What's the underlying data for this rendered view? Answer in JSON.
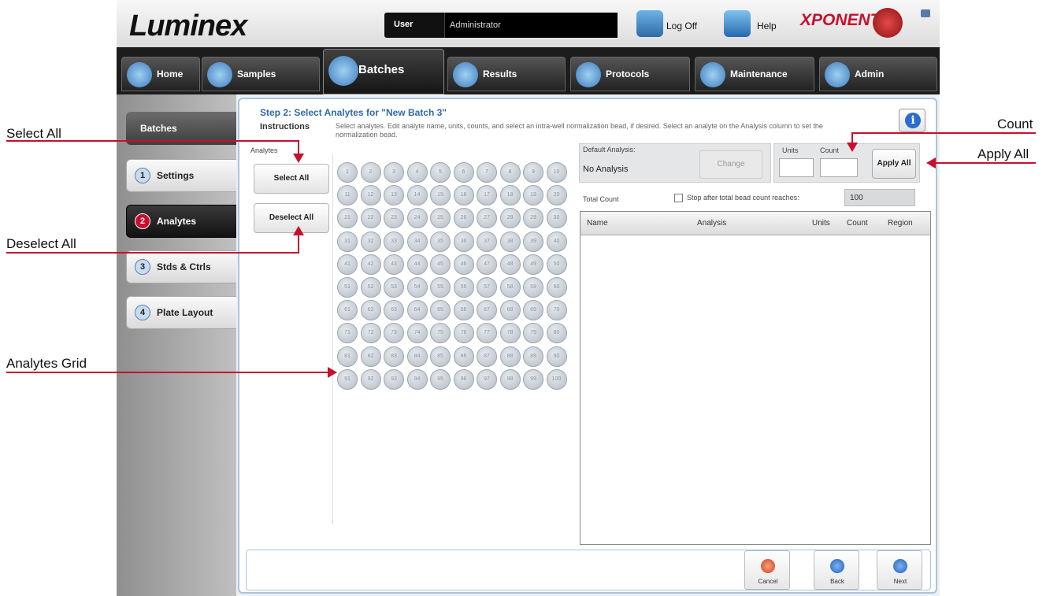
{
  "app": {
    "brand": "Luminex",
    "product": "XPONENT",
    "user_label": "User",
    "user_value": "Administrator",
    "logoff_label": "Log Off",
    "help_label": "Help"
  },
  "nav": {
    "tabs": [
      {
        "label": "Home",
        "icon": "home-icon"
      },
      {
        "label": "Samples",
        "icon": "samples-icon"
      },
      {
        "label": "Batches",
        "icon": "batches-icon",
        "active": true
      },
      {
        "label": "Results",
        "icon": "results-icon"
      },
      {
        "label": "Protocols",
        "icon": "protocols-icon"
      },
      {
        "label": "Maintenance",
        "icon": "maintenance-icon"
      },
      {
        "label": "Admin",
        "icon": "admin-icon"
      }
    ]
  },
  "sidebar": {
    "header": "Batches",
    "steps": [
      {
        "num": "1",
        "label": "Settings"
      },
      {
        "num": "2",
        "label": "Analytes",
        "active": true
      },
      {
        "num": "3",
        "label": "Stds & Ctrls"
      },
      {
        "num": "4",
        "label": "Plate Layout"
      }
    ]
  },
  "main": {
    "title": "Step 2: Select Analytes for \"New Batch 3\"",
    "instructions_label": "Instructions",
    "instructions_text": "Select analytes. Edit analyte name, units, counts, and select an intra-well normalization bead, if desired. Select an analyte on the Analysis column to set the normalization bead.",
    "analytes_label": "Analytes",
    "select_all": "Select All",
    "deselect_all": "Deselect All",
    "default_analysis_label": "Default Analysis:",
    "default_analysis_value": "No Analysis",
    "change_label": "Change",
    "units_label": "Units",
    "count_label": "Count",
    "apply_all": "Apply All",
    "total_count_label": "Total Count",
    "stop_label": "Stop after total bead count reaches:",
    "stop_value": "100",
    "table_headers": [
      "Name",
      "Analysis",
      "Units",
      "Count",
      "Region"
    ]
  },
  "footer": {
    "cancel": "Cancel",
    "back": "Back",
    "next": "Next"
  },
  "callouts": {
    "select_all": "Select All",
    "deselect_all": "Deselect All",
    "analytes_grid": "Analytes Grid",
    "count": "Count",
    "apply_all": "Apply All"
  },
  "colors": {
    "accent_red": "#c8102e",
    "title_blue": "#2f6aa8"
  }
}
